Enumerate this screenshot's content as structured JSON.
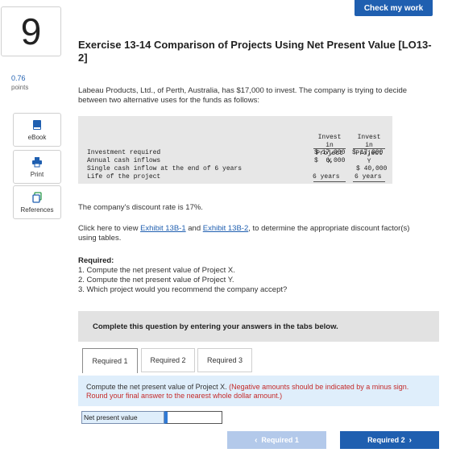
{
  "header": {
    "check_label": "Check my work"
  },
  "question": {
    "number": "9",
    "points_value": "0.76",
    "points_label": "points"
  },
  "tools": [
    {
      "label": "eBook",
      "icon": "ebook-icon"
    },
    {
      "label": "Print",
      "icon": "print-icon"
    },
    {
      "label": "References",
      "icon": "references-icon"
    }
  ],
  "exercise": {
    "title": "Exercise 13-14 Comparison of Projects Using Net Present Value [LO13-2]",
    "intro": "Labeau Products, Ltd., of Perth, Australia, has $17,000 to invest. The company is trying to decide between two alternative uses for the funds as follows:",
    "discount_rate_text": "The company's discount rate is 17%.",
    "exhibit_prefix": "Click here to view ",
    "exhibit_1": "Exhibit 13B-1",
    "exhibit_and": " and ",
    "exhibit_2": "Exhibit 13B-2",
    "exhibit_suffix": ", to determine the appropriate discount factor(s) using tables.",
    "required_heading": "Required:",
    "required_items": [
      "1. Compute the net present value of Project X.",
      "2. Compute the net present value of Project Y.",
      "3. Which project would you recommend the company accept?"
    ]
  },
  "table": {
    "col_x_header": [
      "Invest",
      "in",
      "Project",
      "X"
    ],
    "col_y_header": [
      "Invest",
      "in",
      "Project",
      "Y"
    ],
    "rows": [
      {
        "label": "Investment required",
        "x": "$ 17,000",
        "y": "$ 17,000"
      },
      {
        "label": "Annual cash inflows",
        "x": "$  6,000",
        "y": ""
      },
      {
        "label": "Single cash inflow at the end of 6 years",
        "x": "",
        "y": "$ 40,000"
      },
      {
        "label": "Life of the project",
        "x": "6 years",
        "y": "6 years"
      }
    ]
  },
  "answer_area": {
    "complete_text": "Complete this question by entering your answers in the tabs below.",
    "tabs": [
      "Required 1",
      "Required 2",
      "Required 3"
    ],
    "instruction": "Compute the net present value of Project X.",
    "instruction_note": "(Negative amounts should be indicated by a minus sign. Round your final answer to the nearest whole dollar amount.)",
    "npv_label": "Net present value",
    "npv_value": "",
    "prev_label": "Required 1",
    "next_label": "Required 2"
  },
  "colors": {
    "accent": "#1f5fb0",
    "note_red": "#c42a2a",
    "instruction_bg": "#dfeefb"
  }
}
